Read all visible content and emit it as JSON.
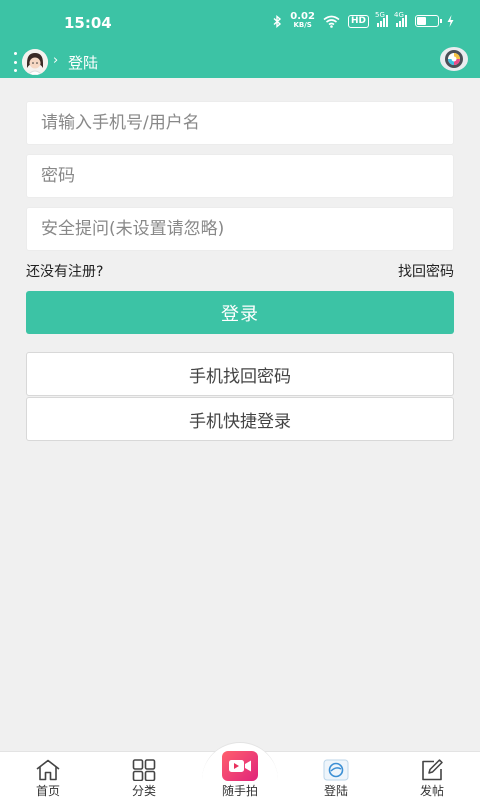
{
  "status_bar": {
    "time": "15:04",
    "speed_value": "0.02",
    "speed_unit": "KB/S",
    "hd_label": "HD",
    "sim1_tag": "5G",
    "sim2_tag": "4G"
  },
  "header": {
    "title": "登陆"
  },
  "form": {
    "username_placeholder": "请输入手机号/用户名",
    "password_placeholder": "密码",
    "security_placeholder": "安全提问(未设置请忽略)",
    "register_link": "还没有注册?",
    "forgot_link": "找回密码",
    "login_button": "登录",
    "phone_recover_button": "手机找回密码",
    "phone_quick_login_button": "手机快捷登录"
  },
  "tab_bar": {
    "items": [
      {
        "label": "首页",
        "icon": "home-icon"
      },
      {
        "label": "分类",
        "icon": "grid-icon"
      },
      {
        "label": "随手拍",
        "icon": "video-camera-icon"
      },
      {
        "label": "登陆",
        "icon": "login-avatar-icon"
      },
      {
        "label": "发帖",
        "icon": "edit-icon"
      }
    ]
  },
  "colors": {
    "accent": "#3cc3a5",
    "background": "#f0f0f0"
  }
}
